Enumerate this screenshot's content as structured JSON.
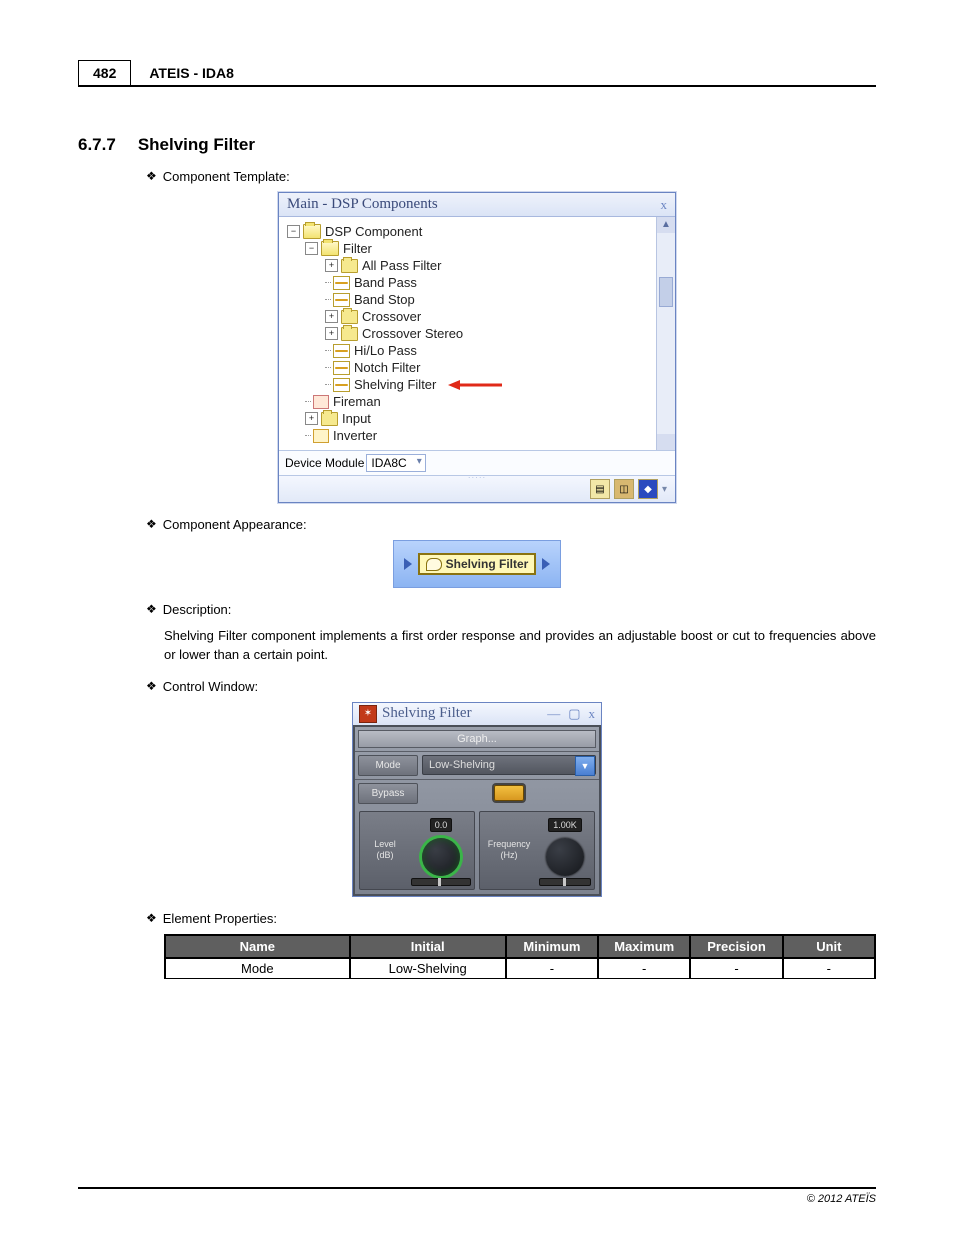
{
  "header": {
    "page_num": "482",
    "title": "ATEIS - IDA8"
  },
  "section": {
    "num": "6.7.7",
    "title": "Shelving Filter"
  },
  "bullets": {
    "template": "Component Template:",
    "appearance": "Component Appearance:",
    "description_label": "Description:",
    "control_window": "Control Window:",
    "element_props": "Element Properties:"
  },
  "description_text": "Shelving Filter component implements a first order response and provides an adjustable boost or cut to frequencies above or lower than a certain point.",
  "tree": {
    "title": "Main - DSP Components",
    "items": {
      "root": "DSP Component",
      "filter": "Filter",
      "allpass": "All Pass Filter",
      "bandpass": "Band Pass",
      "bandstop": "Band Stop",
      "crossover": "Crossover",
      "crossover_stereo": "Crossover Stereo",
      "hilo": "Hi/Lo Pass",
      "notch": "Notch Filter",
      "shelving": "Shelving Filter",
      "fireman": "Fireman",
      "input": "Input",
      "inverter": "Inverter"
    },
    "device_label": "Device Module",
    "device_value": "IDA8C"
  },
  "component_chip": {
    "label": "Shelving Filter"
  },
  "control": {
    "title": "Shelving Filter",
    "graph": "Graph...",
    "mode_label": "Mode",
    "mode_value": "Low-Shelving",
    "bypass_label": "Bypass",
    "level_label": "Level\n(dB)",
    "level_value": "0.0",
    "freq_label": "Frequency\n(Hz)",
    "freq_value": "1.00K"
  },
  "table": {
    "headers": {
      "name": "Name",
      "initial": "Initial",
      "min": "Minimum",
      "max": "Maximum",
      "prec": "Precision",
      "unit": "Unit"
    },
    "row1": {
      "name": "Mode",
      "initial": "Low-Shelving",
      "min": "-",
      "max": "-",
      "prec": "-",
      "unit": "-"
    }
  },
  "footer": "© 2012 ATEÏS"
}
